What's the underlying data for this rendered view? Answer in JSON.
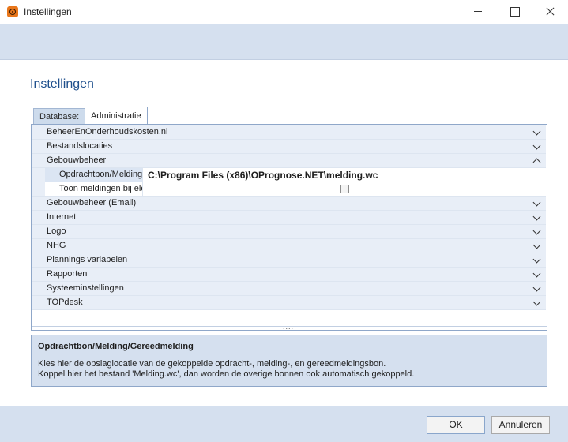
{
  "window": {
    "title": "Instellingen"
  },
  "page": {
    "heading": "Instellingen"
  },
  "tabs": [
    {
      "label": "Database:"
    },
    {
      "label": "Administratie"
    }
  ],
  "grid": {
    "categories": [
      {
        "label": "BeheerEnOnderhoudskosten.nl",
        "expanded": false
      },
      {
        "label": "Bestandslocaties",
        "expanded": false
      },
      {
        "label": "Gebouwbeheer",
        "expanded": true
      },
      {
        "label": "Gebouwbeheer (Email)",
        "expanded": false
      },
      {
        "label": "Internet",
        "expanded": false
      },
      {
        "label": "Logo",
        "expanded": false
      },
      {
        "label": "NHG",
        "expanded": false
      },
      {
        "label": "Plannings variabelen",
        "expanded": false
      },
      {
        "label": "Rapporten",
        "expanded": false
      },
      {
        "label": "Systeeminstellingen",
        "expanded": false
      },
      {
        "label": "TOPdesk",
        "expanded": false
      }
    ],
    "properties": [
      {
        "name": "Opdrachtbon/Melding/Gereedmelding",
        "value": "C:\\Program Files (x86)\\OPrognose.NET\\melding.wc",
        "selected": true
      },
      {
        "name": "Toon meldingen bij elementen",
        "checked": false
      }
    ],
    "splitter": "...."
  },
  "description": {
    "title": "Opdrachtbon/Melding/Gereedmelding",
    "line1": "Kies hier de opslaglocatie van de gekoppelde opdracht-, melding-, en gereedmeldingsbon.",
    "line2": "Koppel hier het bestand 'Melding.wc', dan worden de overige bonnen ook automatisch gekoppeld."
  },
  "footer": {
    "ok_label": "OK",
    "cancel_label": "Annuleren"
  },
  "colors": {
    "accent": "#1e4f8c",
    "band": "#d5e0ef",
    "category_row": "#e8eef7"
  }
}
